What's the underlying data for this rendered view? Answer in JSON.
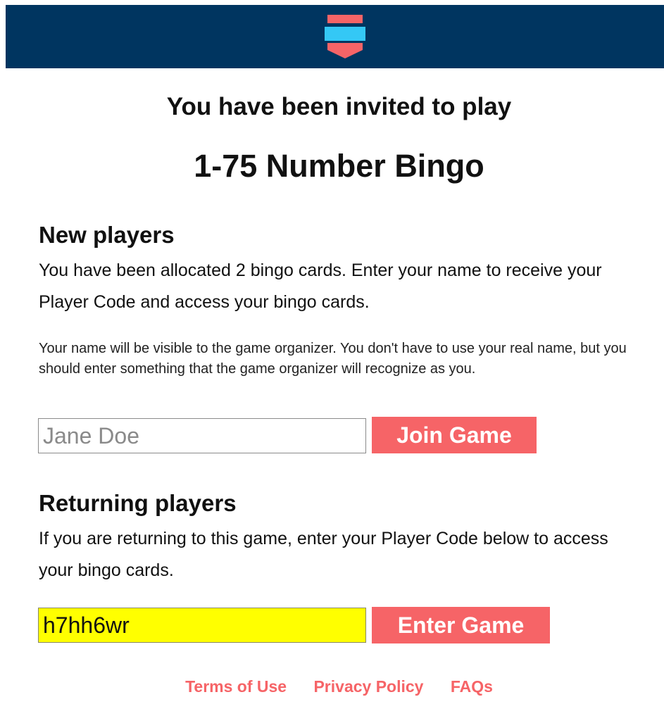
{
  "header": {
    "logo_icon": "bingo-marker-icon",
    "colors": {
      "background": "#003560",
      "logo_top": "#f66467",
      "logo_middle": "#34c8f5",
      "logo_bottom": "#f66467"
    }
  },
  "invite": {
    "subtitle": "You have been invited to play",
    "game_title": "1-75 Number Bingo"
  },
  "new_players": {
    "heading": "New players",
    "description": "You have been allocated 2 bingo cards. Enter your name to receive your Player Code and access your bingo cards.",
    "note": "Your name will be visible to the game organizer. You don't have to use your real name, but you should enter something that the game organizer will recognize as you.",
    "name_placeholder": "Jane Doe",
    "name_value": "",
    "join_label": "Join Game"
  },
  "returning_players": {
    "heading": "Returning players",
    "description": "If you are returning to this game, enter your Player Code below to access your bingo cards.",
    "code_value": "h7hh6wr",
    "enter_label": "Enter Game"
  },
  "footer": {
    "links": [
      {
        "label": "Terms of Use"
      },
      {
        "label": "Privacy Policy"
      },
      {
        "label": "FAQs"
      }
    ]
  },
  "colors": {
    "accent": "#f66467",
    "code_field": "#ffff00"
  }
}
